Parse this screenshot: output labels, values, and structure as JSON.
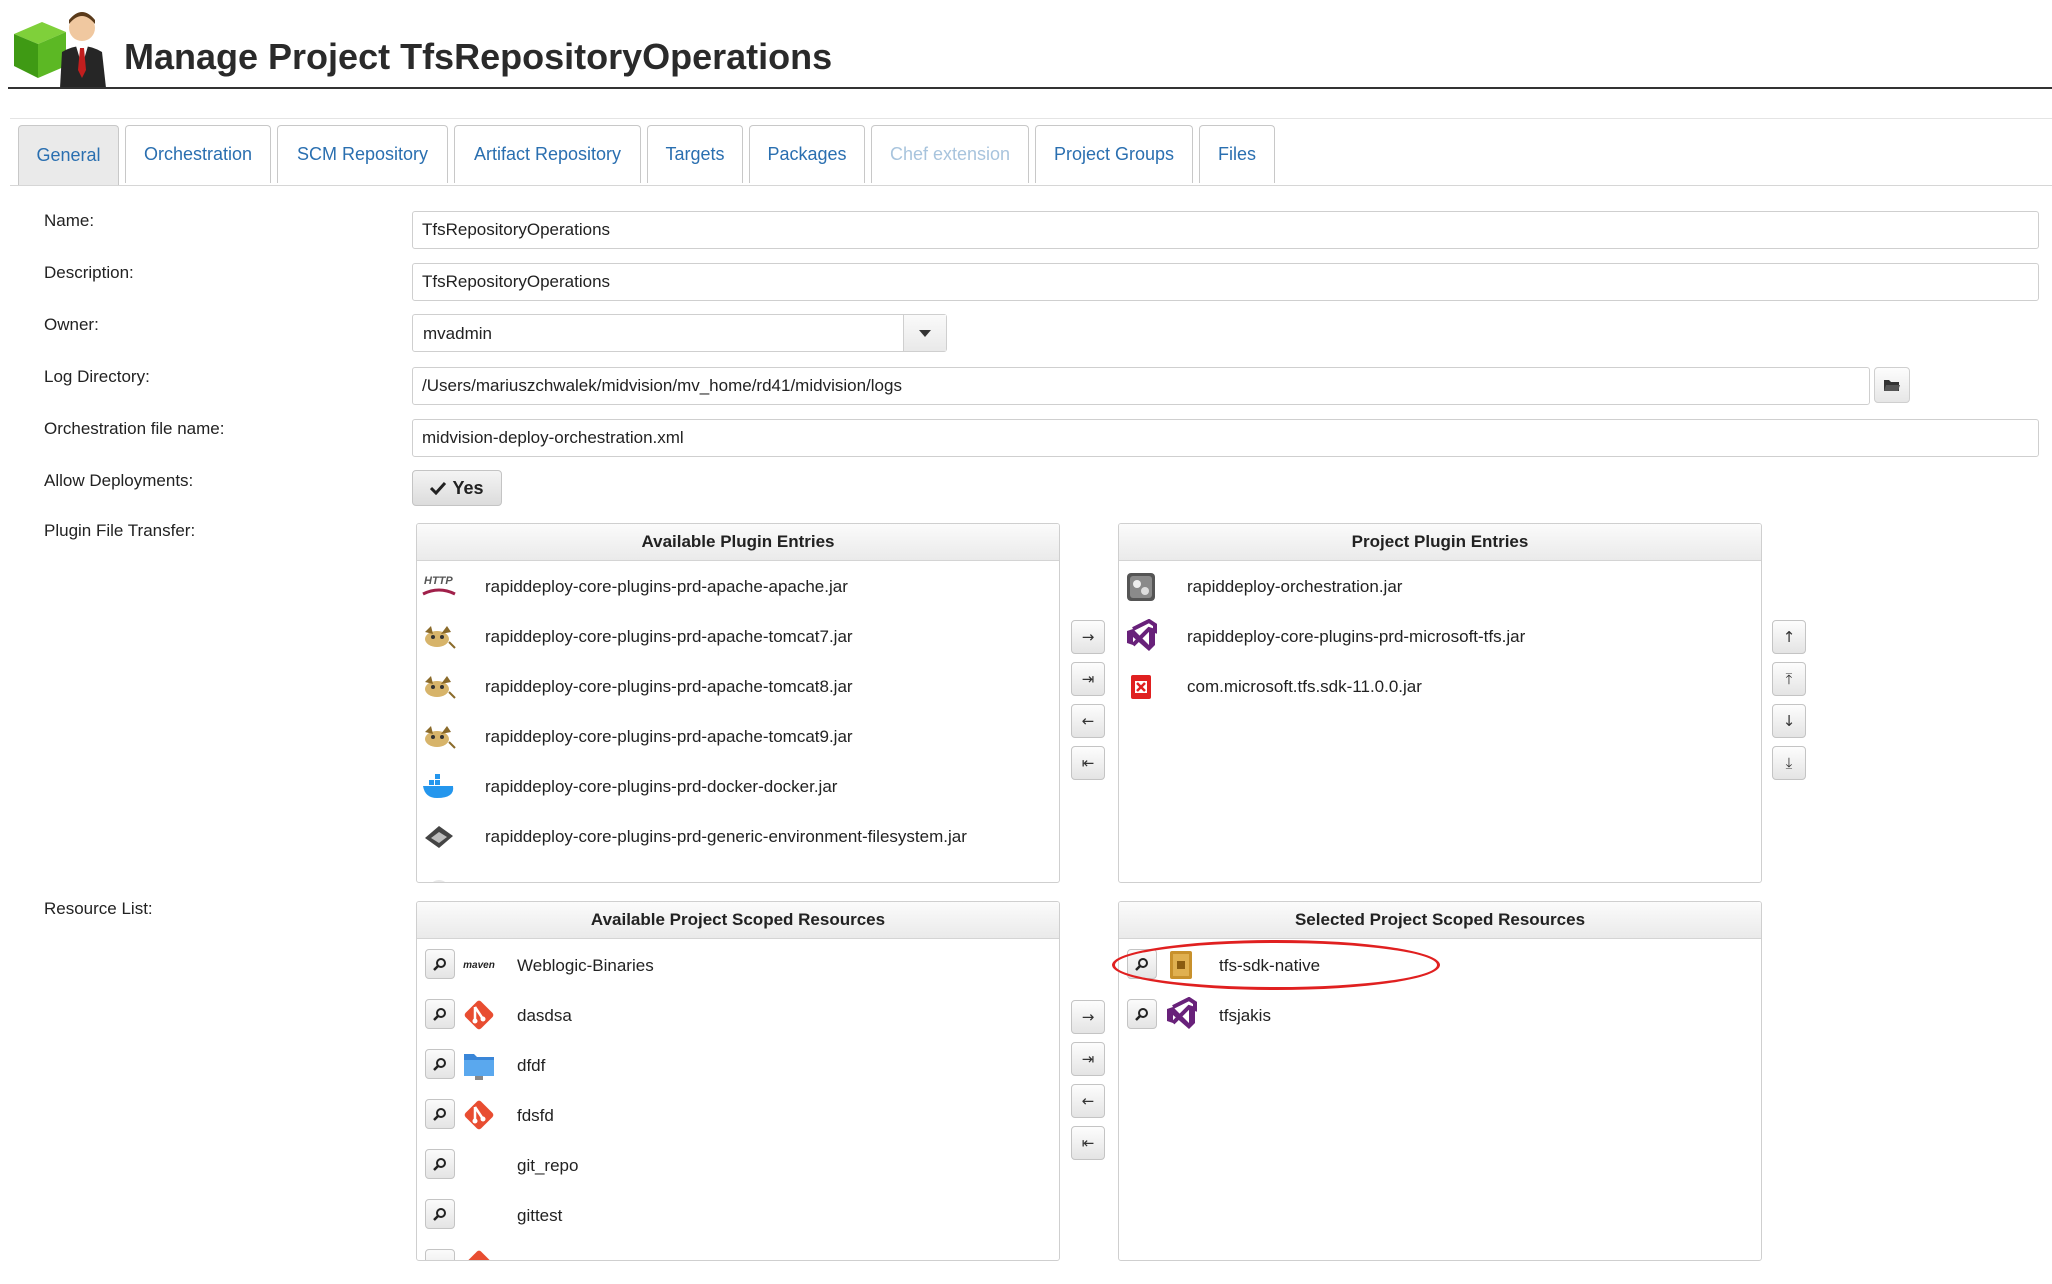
{
  "header": {
    "title": "Manage Project TfsRepositoryOperations",
    "icon": "project-manager-icon"
  },
  "tabs": [
    {
      "label": "General",
      "state": "active"
    },
    {
      "label": "Orchestration",
      "state": "normal"
    },
    {
      "label": "SCM Repository",
      "state": "normal"
    },
    {
      "label": "Artifact Repository",
      "state": "normal"
    },
    {
      "label": "Targets",
      "state": "normal"
    },
    {
      "label": "Packages",
      "state": "normal"
    },
    {
      "label": "Chef extension",
      "state": "disabled"
    },
    {
      "label": "Project Groups",
      "state": "normal"
    },
    {
      "label": "Files",
      "state": "normal"
    }
  ],
  "form": {
    "name_label": "Name:",
    "name_value": "TfsRepositoryOperations",
    "description_label": "Description:",
    "description_value": "TfsRepositoryOperations",
    "owner_label": "Owner:",
    "owner_value": "mvadmin",
    "log_dir_label": "Log Directory:",
    "log_dir_value": "/Users/mariuszchwalek/midvision/mv_home/rd41/midvision/logs",
    "orch_file_label": "Orchestration file name:",
    "orch_file_value": "midvision-deploy-orchestration.xml",
    "allow_deploy_label": "Allow Deployments:",
    "allow_deploy_value": "Yes",
    "plugin_transfer_label": "Plugin File Transfer:",
    "resource_list_label": "Resource List:"
  },
  "available_plugins": {
    "title": "Available Plugin Entries",
    "items": [
      {
        "label": "rapiddeploy-core-plugins-prd-apache-apache.jar",
        "icon": "http-icon"
      },
      {
        "label": "rapiddeploy-core-plugins-prd-apache-tomcat7.jar",
        "icon": "tomcat-icon"
      },
      {
        "label": "rapiddeploy-core-plugins-prd-apache-tomcat8.jar",
        "icon": "tomcat-icon"
      },
      {
        "label": "rapiddeploy-core-plugins-prd-apache-tomcat9.jar",
        "icon": "tomcat-icon"
      },
      {
        "label": "rapiddeploy-core-plugins-prd-docker-docker.jar",
        "icon": "docker-icon"
      },
      {
        "label": "rapiddeploy-core-plugins-prd-generic-environment-filesystem.jar",
        "icon": "filesystem-icon"
      }
    ]
  },
  "project_plugins": {
    "title": "Project Plugin Entries",
    "items": [
      {
        "label": "rapiddeploy-orchestration.jar",
        "icon": "orchestration-icon"
      },
      {
        "label": "rapiddeploy-core-plugins-prd-microsoft-tfs.jar",
        "icon": "visual-studio-icon"
      },
      {
        "label": "com.microsoft.tfs.sdk-11.0.0.jar",
        "icon": "jar-error-icon"
      }
    ]
  },
  "available_resources": {
    "title": "Available Project Scoped Resources",
    "items": [
      {
        "label": "Weblogic-Binaries",
        "icon": "maven-icon",
        "badge": "maven"
      },
      {
        "label": "dasdsa",
        "icon": "git-icon"
      },
      {
        "label": "dfdf",
        "icon": "folder-icon"
      },
      {
        "label": "fdsfd",
        "icon": "git-icon"
      },
      {
        "label": "git_repo",
        "icon": ""
      },
      {
        "label": "gittest",
        "icon": ""
      }
    ]
  },
  "selected_resources": {
    "title": "Selected Project Scoped Resources",
    "items": [
      {
        "label": "tfs-sdk-native",
        "icon": "archive-icon"
      },
      {
        "label": "tfsjakis",
        "icon": "visual-studio-icon"
      }
    ]
  },
  "mover_buttons": [
    "→",
    "⇥",
    "←",
    "⇤"
  ],
  "order_buttons": [
    "↑",
    "⤒",
    "↓",
    "⤓"
  ],
  "colors": {
    "accent": "#2a6fb0",
    "highlight": "#e02020",
    "visual_studio": "#68217a",
    "git": "#e84d31"
  }
}
